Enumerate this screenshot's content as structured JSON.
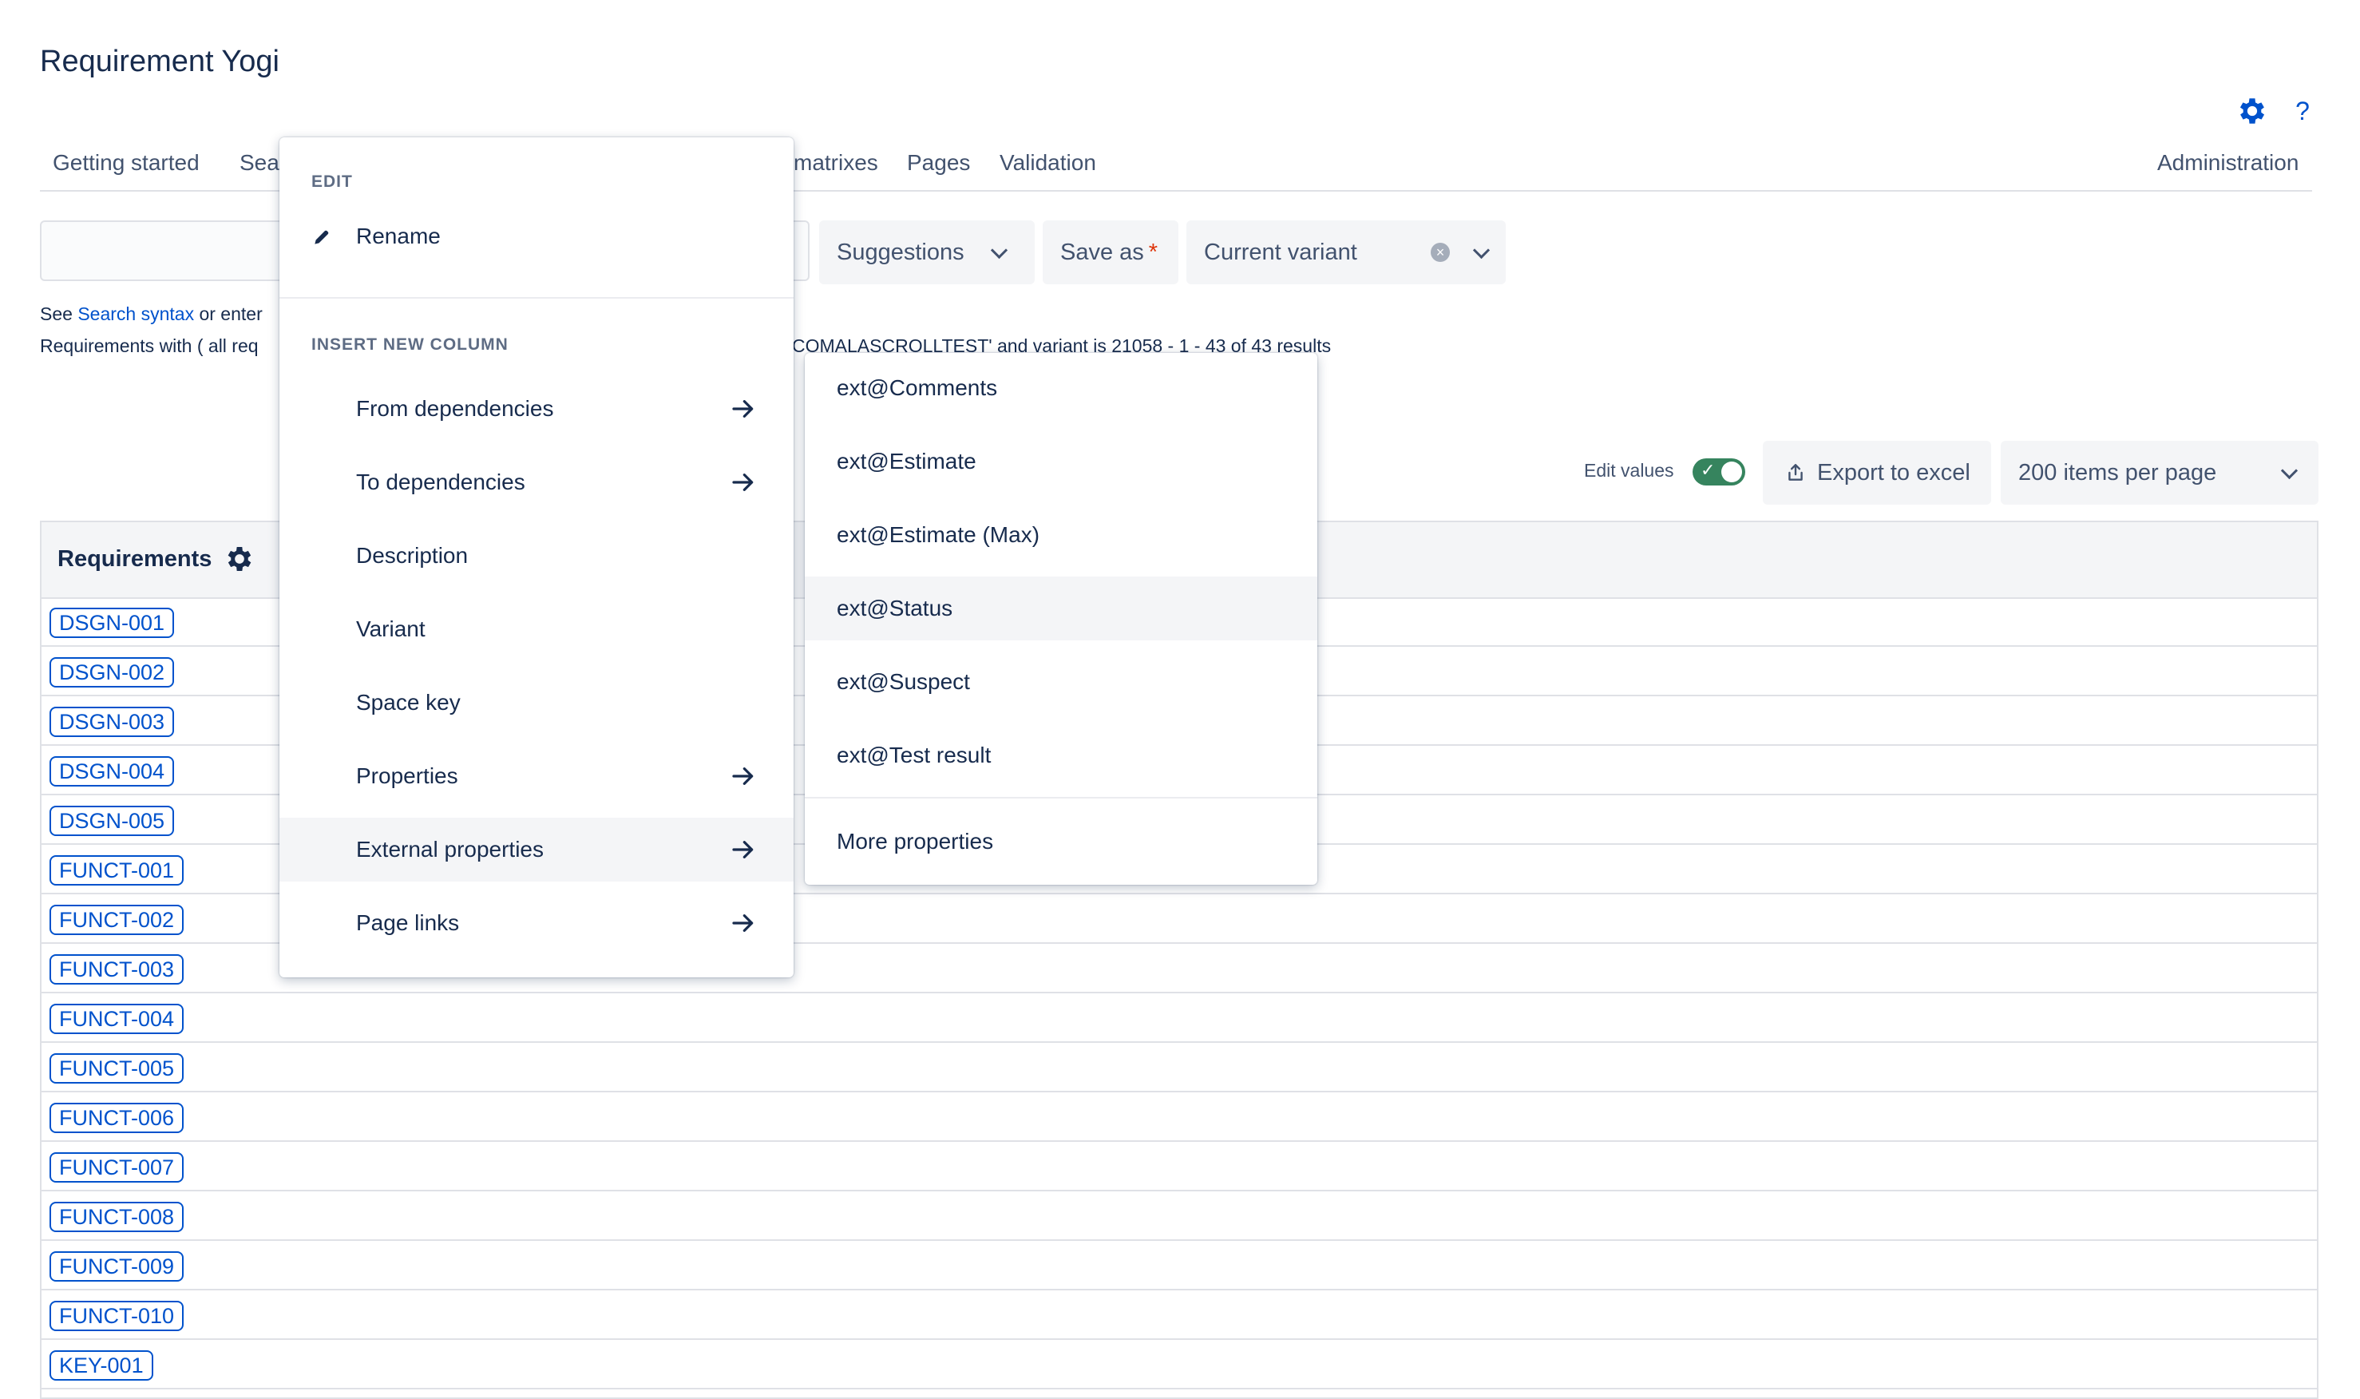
{
  "app": {
    "title": "Requirement Yogi"
  },
  "nav": {
    "tabs": [
      {
        "label": "Getting started"
      },
      {
        "label": "Sea"
      },
      {
        "label": "matrixes"
      },
      {
        "label": "Pages"
      },
      {
        "label": "Validation"
      }
    ],
    "administration": "Administration",
    "help_label": "?"
  },
  "search": {
    "value": ""
  },
  "toolbar": {
    "suggestions_label": "Suggestions",
    "save_as_label": "Save as",
    "save_as_required": "*",
    "variant_value": "Current variant",
    "variant_clear": "×"
  },
  "help": {
    "see": "See ",
    "search_syntax": "Search syntax",
    "line1_rest": " or enter",
    "line2_left": "Requirements with ( all req",
    "line2_right": "COMALASCROLLTEST' and variant is 21058 - 1 - 43 of 43 results"
  },
  "controls": {
    "edit_values_label": "Edit values",
    "edit_values_on": true,
    "toggle_check": "✓",
    "export_label": "Export to excel",
    "per_page_value": "200 items per page"
  },
  "table": {
    "column_header": "Requirements",
    "rows": [
      "DSGN-001",
      "DSGN-002",
      "DSGN-003",
      "DSGN-004",
      "DSGN-005",
      "FUNCT-001",
      "FUNCT-002",
      "FUNCT-003",
      "FUNCT-004",
      "FUNCT-005",
      "FUNCT-006",
      "FUNCT-007",
      "FUNCT-008",
      "FUNCT-009",
      "FUNCT-010",
      "KEY-001"
    ]
  },
  "context_menu": {
    "edit_section": "EDIT",
    "rename": "Rename",
    "insert_section": "INSERT NEW COLUMN",
    "items": [
      {
        "label": "From dependencies",
        "has_submenu": true
      },
      {
        "label": "To dependencies",
        "has_submenu": true
      },
      {
        "label": "Description",
        "has_submenu": false
      },
      {
        "label": "Variant",
        "has_submenu": false
      },
      {
        "label": "Space key",
        "has_submenu": false
      },
      {
        "label": "Properties",
        "has_submenu": true
      },
      {
        "label": "External properties",
        "has_submenu": true,
        "highlighted": true
      },
      {
        "label": "Page links",
        "has_submenu": true
      }
    ]
  },
  "submenu": {
    "items": [
      {
        "label": "ext@Comments"
      },
      {
        "label": "ext@Estimate"
      },
      {
        "label": "ext@Estimate (Max)"
      },
      {
        "label": "ext@Status",
        "highlighted": true
      },
      {
        "label": "ext@Suspect"
      },
      {
        "label": "ext@Test result"
      }
    ],
    "more": "More properties"
  },
  "colors": {
    "link": "#0052cc",
    "text": "#172b4d",
    "toggle_on": "#36845e",
    "highlight": "#f4f5f7"
  }
}
